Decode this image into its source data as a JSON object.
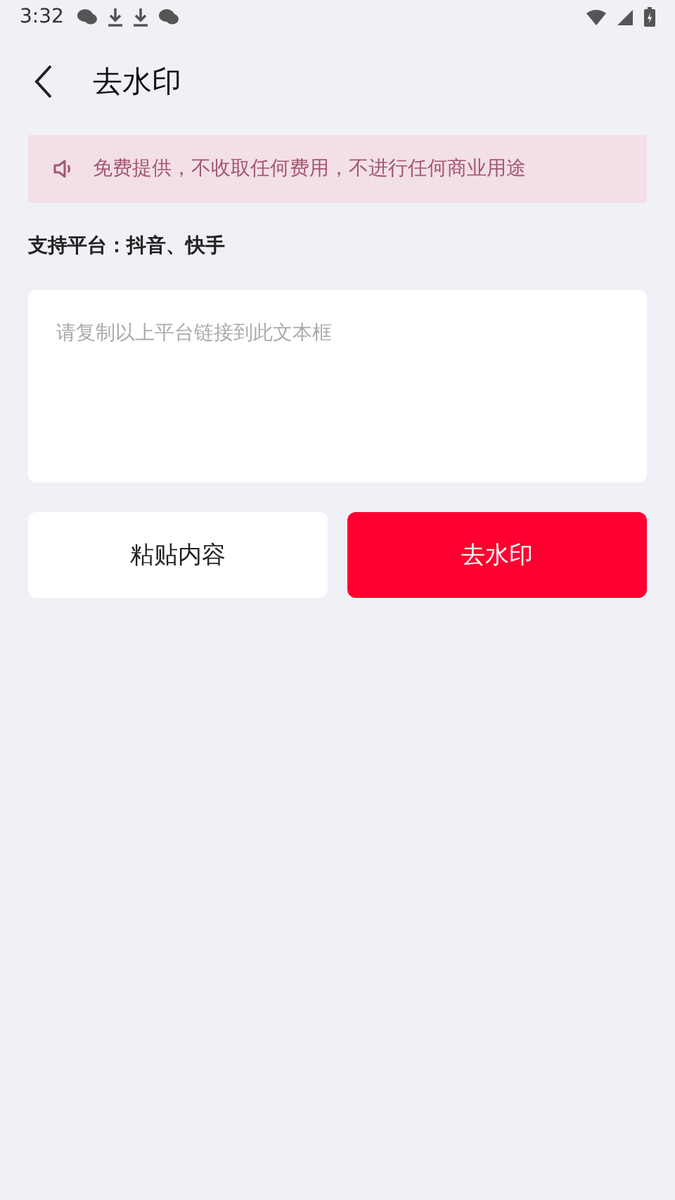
{
  "status_bar": {
    "time": "3:32"
  },
  "header": {
    "title": "去水印"
  },
  "notice": {
    "text": "免费提供，不收取任何费用，不进行任何商业用途"
  },
  "platforms": {
    "label": "支持平台：",
    "value": "抖音、快手"
  },
  "link_field": {
    "placeholder": "请复制以上平台链接到此文本框"
  },
  "buttons": [
    {
      "label": "粘贴内容",
      "kind": "secondary"
    },
    {
      "label": "去水印",
      "kind": "primary"
    }
  ]
}
